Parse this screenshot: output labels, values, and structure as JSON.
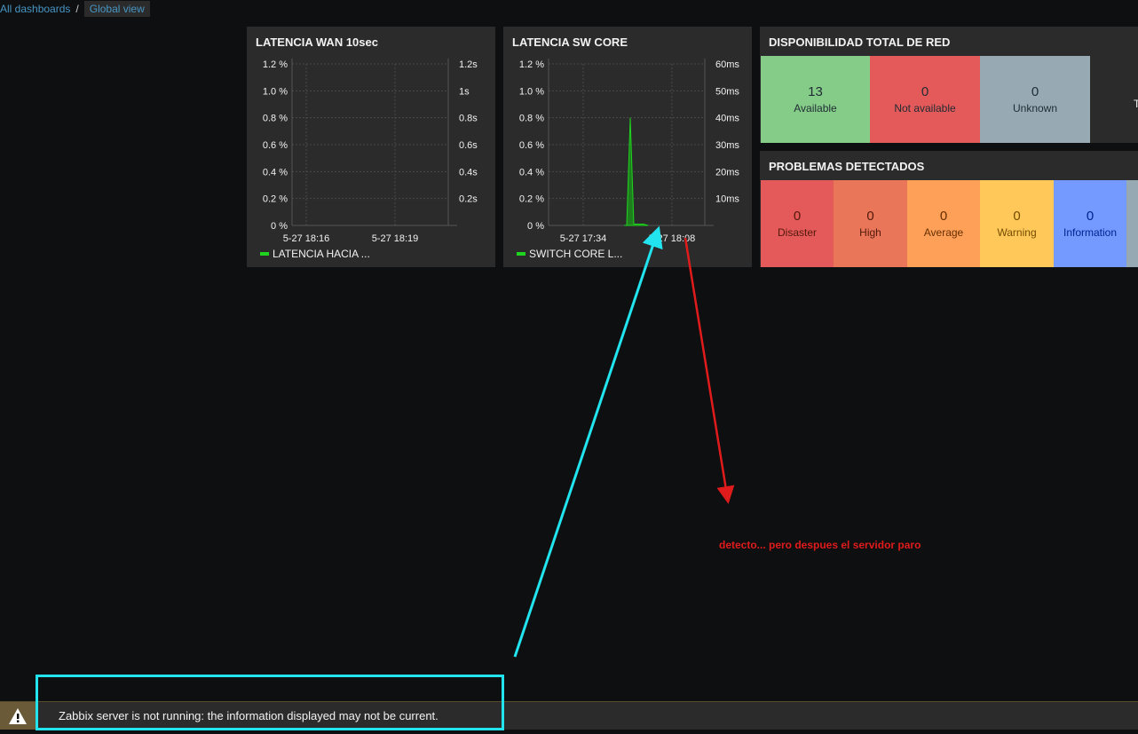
{
  "breadcrumb": {
    "items": [
      {
        "label": "All dashboards"
      },
      {
        "label": "Global view"
      }
    ],
    "separator": "/"
  },
  "widgets": {
    "wan": {
      "title": "LATENCIA WAN 10sec",
      "legend": "LATENCIA HACIA ...",
      "left_ticks": [
        "1.2 %",
        "1.0 %",
        "0.8 %",
        "0.6 %",
        "0.4 %",
        "0.2 %",
        "0 %"
      ],
      "right_ticks": [
        "1.2s",
        "1s",
        "0.8s",
        "0.6s",
        "0.4s",
        "0.2s"
      ],
      "x_ticks": [
        "5-27 18:16",
        "5-27 18:19"
      ]
    },
    "core": {
      "title": "LATENCIA SW CORE",
      "legend": "SWITCH CORE L...",
      "left_ticks": [
        "1.2 %",
        "1.0 %",
        "0.8 %",
        "0.6 %",
        "0.4 %",
        "0.2 %",
        "0 %"
      ],
      "right_ticks": [
        "60ms",
        "50ms",
        "40ms",
        "30ms",
        "20ms",
        "10ms"
      ],
      "x_ticks": [
        "5-27 17:34",
        "5-27 18:08"
      ]
    },
    "availability": {
      "title": "DISPONIBILIDAD TOTAL DE RED",
      "tiles": [
        {
          "value": "13",
          "label": "Available",
          "color": "#86cc89"
        },
        {
          "value": "0",
          "label": "Not available",
          "color": "#e45959"
        },
        {
          "value": "0",
          "label": "Unknown",
          "color": "#97aab3"
        }
      ],
      "cut_text": "T"
    },
    "problems": {
      "title": "PROBLEMAS DETECTADOS",
      "tiles": [
        {
          "value": "0",
          "label": "Disaster",
          "color": "#e45959",
          "text": "#52190b"
        },
        {
          "value": "0",
          "label": "High",
          "color": "#e97659",
          "text": "#52190b"
        },
        {
          "value": "0",
          "label": "Average",
          "color": "#ffa059",
          "text": "#662e00"
        },
        {
          "value": "0",
          "label": "Warning",
          "color": "#ffc859",
          "text": "#734d00"
        },
        {
          "value": "0",
          "label": "Information",
          "color": "#7499ff",
          "text": "#00268e"
        },
        {
          "value": "",
          "label": "",
          "color": "#97aab3",
          "text": "#000"
        }
      ]
    }
  },
  "chart_data": [
    {
      "type": "line",
      "title": "LATENCIA WAN 10sec",
      "series": [
        {
          "name": "LATENCIA HACIA ...",
          "values": []
        }
      ],
      "ylim": [
        0,
        1.2
      ],
      "y2lim": [
        0,
        1.2
      ],
      "x_ticks": [
        "5-27 18:16",
        "5-27 18:19"
      ],
      "grid": true
    },
    {
      "type": "area",
      "title": "LATENCIA SW CORE",
      "series": [
        {
          "name": "SWITCH CORE L...",
          "unit": "ms",
          "values": [
            0,
            0,
            40,
            0.5,
            0.5,
            0.5,
            0
          ]
        }
      ],
      "ylim": [
        0,
        1.2
      ],
      "y2lim": [
        0,
        60
      ],
      "x_ticks": [
        "5-27 17:34",
        "5-27 18:08"
      ],
      "grid": true
    }
  ],
  "status_bar": {
    "message": "Zabbix server is not running: the information displayed may not be current.",
    "icon": "warning-icon"
  },
  "annotation": {
    "text": "detecto... pero despues el servidor paro",
    "colors": {
      "cyan": "#22e4ee",
      "red": "#e01b1b"
    }
  }
}
